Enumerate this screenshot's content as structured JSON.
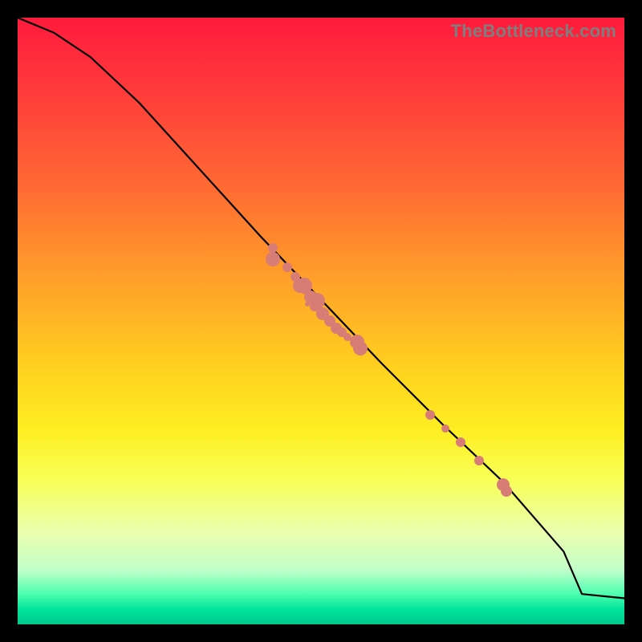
{
  "watermark": "TheBottleneck.com",
  "colors": {
    "point": "#d87d76",
    "curve": "#000000",
    "frame": "#000000"
  },
  "chart_data": {
    "type": "scatter",
    "title": "",
    "xlabel": "",
    "ylabel": "",
    "xlim": [
      0,
      100
    ],
    "ylim": [
      0,
      100
    ],
    "curve": {
      "x": [
        0,
        6,
        12,
        20,
        30,
        40,
        50,
        60,
        70,
        80,
        90,
        93,
        100
      ],
      "y": [
        100,
        97.5,
        93.5,
        86,
        75,
        64,
        53.5,
        43,
        33,
        23.5,
        12,
        5,
        4.3
      ]
    },
    "series": [
      {
        "name": "cluster-upper",
        "points": [
          {
            "x": 42.0,
            "y": 62.0,
            "r": 6
          },
          {
            "x": 42.0,
            "y": 60.2,
            "r": 9
          },
          {
            "x": 44.5,
            "y": 58.8,
            "r": 6
          },
          {
            "x": 45.8,
            "y": 57.3,
            "r": 6
          },
          {
            "x": 46.5,
            "y": 55.8,
            "r": 9
          },
          {
            "x": 47.2,
            "y": 55.8,
            "r": 10
          },
          {
            "x": 48.3,
            "y": 54.0,
            "r": 8
          },
          {
            "x": 49.3,
            "y": 53.3,
            "r": 10
          },
          {
            "x": 49.0,
            "y": 52.4,
            "r": 6
          },
          {
            "x": 50.3,
            "y": 51.2,
            "r": 8
          },
          {
            "x": 51.5,
            "y": 50.0,
            "r": 7
          },
          {
            "x": 52.5,
            "y": 48.8,
            "r": 7
          },
          {
            "x": 53.5,
            "y": 48.2,
            "r": 6
          },
          {
            "x": 54.3,
            "y": 47.3,
            "r": 5
          },
          {
            "x": 56.0,
            "y": 46.5,
            "r": 9
          },
          {
            "x": 56.5,
            "y": 45.5,
            "r": 9
          },
          {
            "x": 47.8,
            "y": 54.0,
            "r": 4
          },
          {
            "x": 47.7,
            "y": 52.8,
            "r": 3
          }
        ]
      },
      {
        "name": "cluster-lower",
        "points": [
          {
            "x": 68.0,
            "y": 34.5,
            "r": 6
          },
          {
            "x": 70.5,
            "y": 32.3,
            "r": 5
          },
          {
            "x": 73.0,
            "y": 30.0,
            "r": 6
          },
          {
            "x": 76.0,
            "y": 27.0,
            "r": 6
          },
          {
            "x": 80.0,
            "y": 23.0,
            "r": 8
          },
          {
            "x": 80.5,
            "y": 22.0,
            "r": 7
          }
        ]
      }
    ]
  }
}
